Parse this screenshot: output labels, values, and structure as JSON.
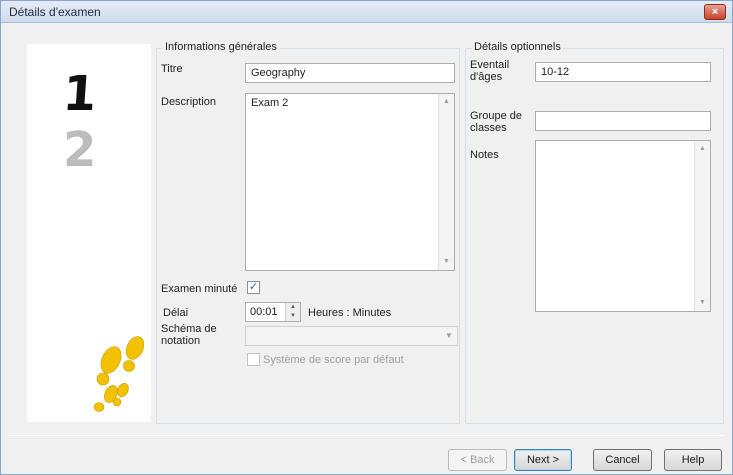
{
  "window": {
    "title": "Détails d'examen",
    "close_glyph": "×"
  },
  "steps": {
    "current": "1",
    "next": "2"
  },
  "general": {
    "group_title": "Informations générales",
    "title_label": "Titre",
    "title_value": "Geography",
    "description_label": "Description",
    "description_value": "Exam 2",
    "timed_label": "Examen minuté",
    "timed_checked": true,
    "delay_label": "Délai",
    "delay_value": "00:01",
    "delay_unit": "Heures : Minutes",
    "scheme_label": "Schéma de notation",
    "scheme_value": "",
    "default_score_label": "Système de score par défaut",
    "default_score_checked": false
  },
  "optional": {
    "group_title": "Détails optionnels",
    "age_label": "Eventail d'âges",
    "age_value": "10-12",
    "class_group_label": "Groupe de classes",
    "class_group_value": "",
    "notes_label": "Notes",
    "notes_value": ""
  },
  "buttons": {
    "back": "< Back",
    "next": "Next >",
    "cancel": "Cancel",
    "help": "Help"
  },
  "colors": {
    "footprint": "#f2c200",
    "step_current": "#111111",
    "step_next": "#b8b8b8"
  }
}
